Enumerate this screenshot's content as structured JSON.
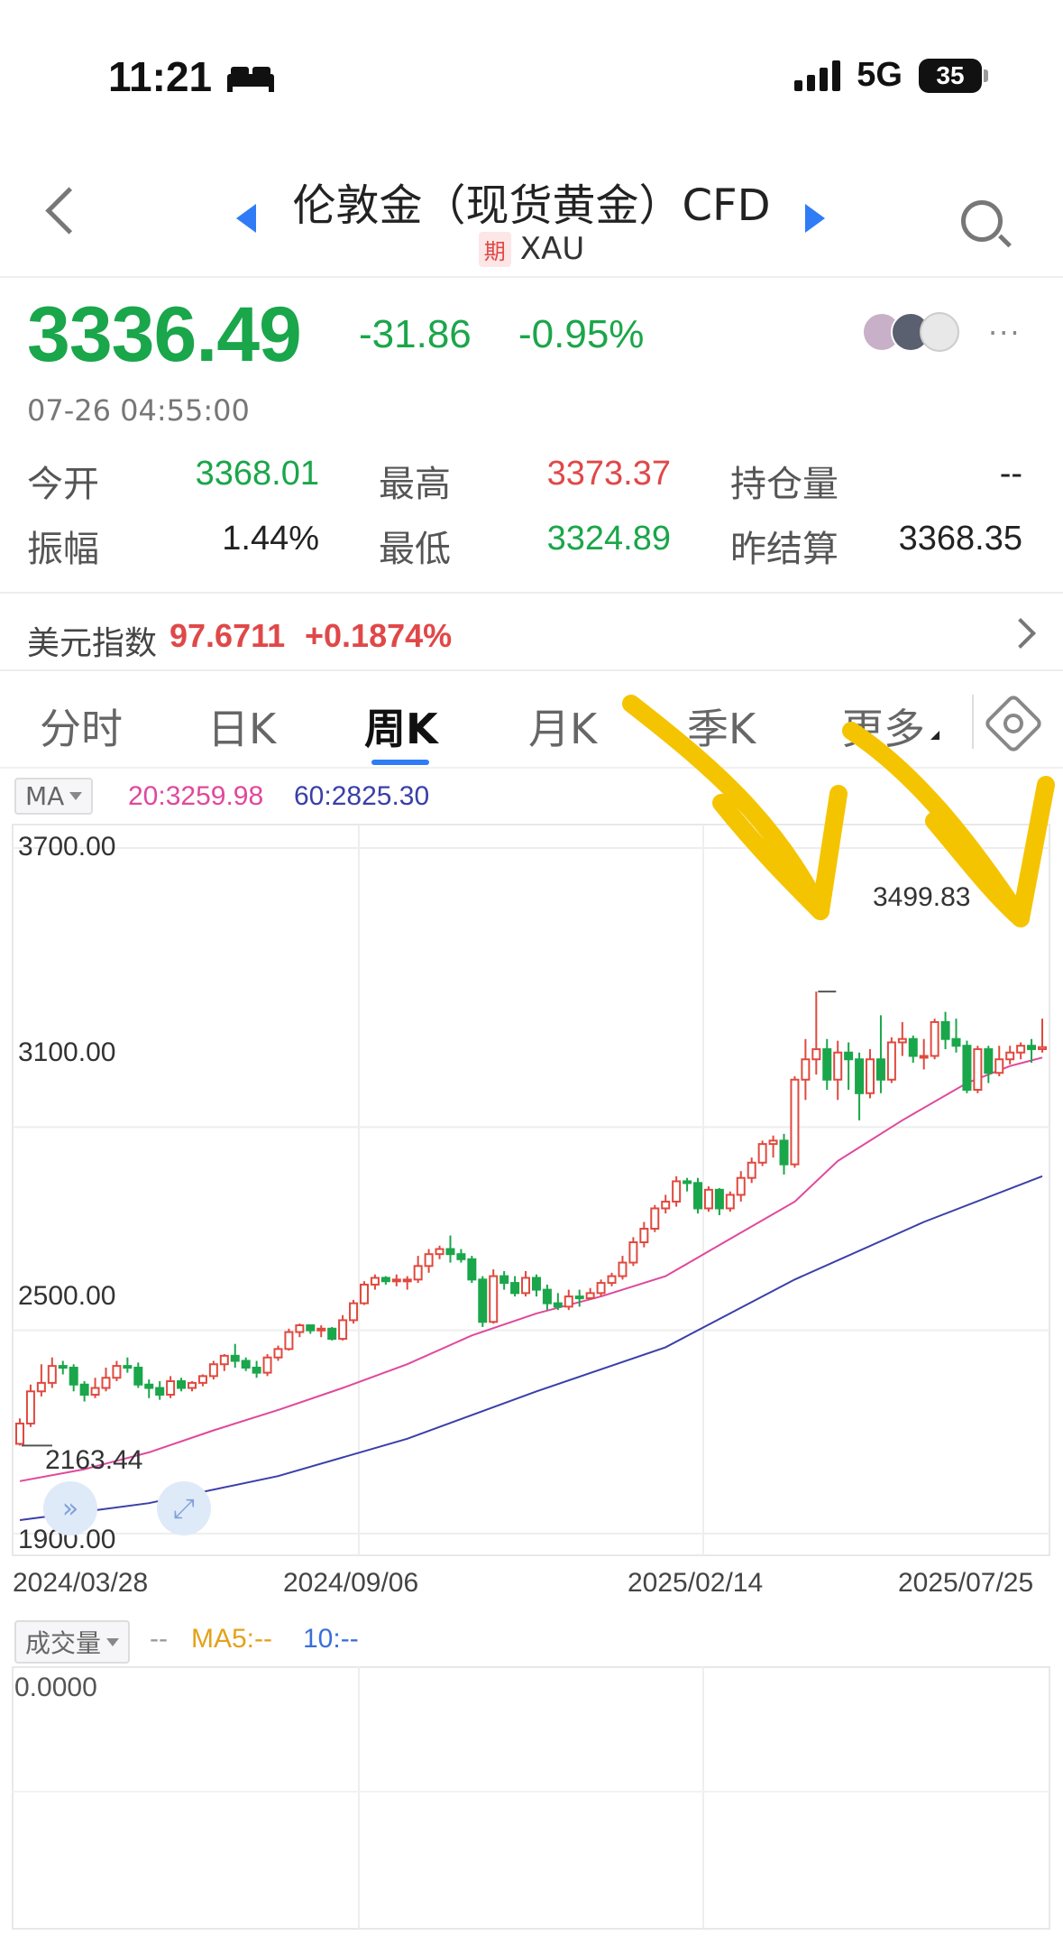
{
  "status_bar": {
    "time": "11:21",
    "network": "5G",
    "battery": "35"
  },
  "header": {
    "title": "伦敦金（现货黄金）CFD",
    "badge": "期",
    "symbol": "XAU"
  },
  "quote": {
    "price": "3336.49",
    "change": "-31.86",
    "change_pct": "-0.95%",
    "timestamp": "07-26 04:55:00",
    "colors": {
      "down": "#1aa64a",
      "up": "#e04848"
    }
  },
  "stats": {
    "open_label": "今开",
    "open": "3368.01",
    "high_label": "最高",
    "high": "3373.37",
    "oi_label": "持仓量",
    "oi": "--",
    "amp_label": "振幅",
    "amp": "1.44%",
    "low_label": "最低",
    "low": "3324.89",
    "settle_label": "昨结算",
    "settle": "3368.35"
  },
  "dxy": {
    "label": "美元指数",
    "value": "97.6711",
    "change": "+0.1874%"
  },
  "tabs": [
    "分时",
    "日K",
    "周K",
    "月K",
    "季K",
    "更多"
  ],
  "active_tab": "周K",
  "ma_legend": {
    "select": "MA",
    "ma20": "20:3259.98",
    "ma60": "60:2825.30"
  },
  "chart_data": {
    "type": "candlestick",
    "y_ticks": [
      "3700.00",
      "3100.00",
      "2500.00",
      "1900.00"
    ],
    "y_range": [
      1900,
      3700
    ],
    "x_ticks": [
      "2024/03/28",
      "2024/09/06",
      "2025/02/14",
      "2025/07/25"
    ],
    "high_marker": "3499.83",
    "low_marker": "2163.44",
    "colors": {
      "up": "#e0493f",
      "down": "#1aa64a",
      "ma20": "#e0489c",
      "ma60": "#3a3fa8",
      "annotation": "#f5c400"
    },
    "candles": [
      [
        2165,
        2225,
        2160,
        2240
      ],
      [
        2225,
        2320,
        2215,
        2340
      ],
      [
        2320,
        2345,
        2305,
        2400
      ],
      [
        2345,
        2395,
        2330,
        2420
      ],
      [
        2395,
        2390,
        2370,
        2410
      ],
      [
        2390,
        2340,
        2320,
        2400
      ],
      [
        2340,
        2310,
        2290,
        2350
      ],
      [
        2310,
        2330,
        2300,
        2360
      ],
      [
        2330,
        2360,
        2320,
        2390
      ],
      [
        2360,
        2395,
        2350,
        2410
      ],
      [
        2395,
        2390,
        2375,
        2420
      ],
      [
        2390,
        2340,
        2330,
        2405
      ],
      [
        2340,
        2330,
        2300,
        2355
      ],
      [
        2330,
        2310,
        2295,
        2350
      ],
      [
        2310,
        2350,
        2300,
        2365
      ],
      [
        2350,
        2330,
        2320,
        2360
      ],
      [
        2330,
        2345,
        2320,
        2350
      ],
      [
        2345,
        2365,
        2335,
        2370
      ],
      [
        2365,
        2400,
        2355,
        2410
      ],
      [
        2400,
        2425,
        2380,
        2430
      ],
      [
        2425,
        2410,
        2390,
        2460
      ],
      [
        2410,
        2390,
        2380,
        2420
      ],
      [
        2390,
        2375,
        2360,
        2410
      ],
      [
        2375,
        2420,
        2365,
        2430
      ],
      [
        2420,
        2445,
        2410,
        2455
      ],
      [
        2445,
        2495,
        2440,
        2505
      ],
      [
        2495,
        2515,
        2480,
        2520
      ],
      [
        2515,
        2500,
        2490,
        2515
      ],
      [
        2500,
        2505,
        2480,
        2515
      ],
      [
        2505,
        2475,
        2470,
        2510
      ],
      [
        2475,
        2530,
        2470,
        2545
      ],
      [
        2530,
        2580,
        2520,
        2590
      ],
      [
        2580,
        2635,
        2575,
        2645
      ],
      [
        2635,
        2655,
        2620,
        2665
      ],
      [
        2655,
        2645,
        2635,
        2660
      ],
      [
        2645,
        2650,
        2630,
        2665
      ],
      [
        2650,
        2650,
        2620,
        2660
      ],
      [
        2650,
        2690,
        2640,
        2720
      ],
      [
        2690,
        2725,
        2670,
        2740
      ],
      [
        2725,
        2740,
        2710,
        2750
      ],
      [
        2740,
        2725,
        2700,
        2780
      ],
      [
        2725,
        2710,
        2700,
        2740
      ],
      [
        2710,
        2650,
        2640,
        2720
      ],
      [
        2650,
        2525,
        2510,
        2660
      ],
      [
        2525,
        2660,
        2520,
        2680
      ],
      [
        2660,
        2640,
        2620,
        2675
      ],
      [
        2640,
        2610,
        2600,
        2660
      ],
      [
        2610,
        2655,
        2600,
        2675
      ],
      [
        2655,
        2620,
        2600,
        2665
      ],
      [
        2620,
        2580,
        2560,
        2635
      ],
      [
        2580,
        2570,
        2560,
        2610
      ],
      [
        2570,
        2600,
        2560,
        2620
      ],
      [
        2600,
        2595,
        2570,
        2620
      ],
      [
        2595,
        2610,
        2590,
        2625
      ],
      [
        2610,
        2640,
        2600,
        2650
      ],
      [
        2640,
        2660,
        2630,
        2670
      ],
      [
        2660,
        2700,
        2650,
        2720
      ],
      [
        2700,
        2760,
        2690,
        2775
      ],
      [
        2760,
        2800,
        2745,
        2820
      ],
      [
        2800,
        2860,
        2790,
        2870
      ],
      [
        2860,
        2880,
        2845,
        2900
      ],
      [
        2880,
        2940,
        2865,
        2955
      ],
      [
        2940,
        2935,
        2910,
        2950
      ],
      [
        2935,
        2860,
        2845,
        2950
      ],
      [
        2860,
        2915,
        2850,
        2925
      ],
      [
        2915,
        2860,
        2840,
        2920
      ],
      [
        2860,
        2900,
        2850,
        2910
      ],
      [
        2900,
        2950,
        2880,
        2970
      ],
      [
        2950,
        2995,
        2935,
        3010
      ],
      [
        2995,
        3050,
        2985,
        3060
      ],
      [
        3050,
        3060,
        3010,
        3075
      ],
      [
        3060,
        2990,
        2960,
        3080
      ],
      [
        2990,
        3240,
        2980,
        3250
      ],
      [
        3240,
        3300,
        3180,
        3360
      ],
      [
        3300,
        3330,
        3255,
        3500
      ],
      [
        3330,
        3240,
        3210,
        3360
      ],
      [
        3240,
        3320,
        3180,
        3355
      ],
      [
        3320,
        3300,
        3210,
        3350
      ],
      [
        3300,
        3200,
        3120,
        3320
      ],
      [
        3200,
        3300,
        3185,
        3330
      ],
      [
        3300,
        3240,
        3200,
        3430
      ],
      [
        3240,
        3350,
        3230,
        3365
      ],
      [
        3350,
        3360,
        3310,
        3410
      ],
      [
        3360,
        3310,
        3290,
        3370
      ],
      [
        3310,
        3310,
        3270,
        3360
      ],
      [
        3310,
        3410,
        3300,
        3420
      ],
      [
        3410,
        3360,
        3330,
        3440
      ],
      [
        3360,
        3340,
        3320,
        3420
      ],
      [
        3340,
        3210,
        3200,
        3355
      ],
      [
        3210,
        3330,
        3200,
        3340
      ],
      [
        3330,
        3260,
        3230,
        3340
      ],
      [
        3260,
        3300,
        3250,
        3340
      ],
      [
        3300,
        3320,
        3285,
        3340
      ],
      [
        3320,
        3340,
        3300,
        3350
      ],
      [
        3340,
        3330,
        3290,
        3360
      ],
      [
        3330,
        3336,
        3320,
        3420
      ]
    ],
    "ma20": [
      [
        0,
        2055
      ],
      [
        6,
        2090
      ],
      [
        12,
        2140
      ],
      [
        18,
        2205
      ],
      [
        24,
        2265
      ],
      [
        30,
        2330
      ],
      [
        36,
        2400
      ],
      [
        42,
        2485
      ],
      [
        48,
        2550
      ],
      [
        54,
        2600
      ],
      [
        60,
        2660
      ],
      [
        66,
        2770
      ],
      [
        72,
        2880
      ],
      [
        76,
        3000
      ],
      [
        82,
        3120
      ],
      [
        88,
        3230
      ],
      [
        92,
        3280
      ],
      [
        95,
        3305
      ]
    ],
    "ma60": [
      [
        0,
        1940
      ],
      [
        12,
        1990
      ],
      [
        24,
        2070
      ],
      [
        36,
        2180
      ],
      [
        48,
        2320
      ],
      [
        60,
        2450
      ],
      [
        72,
        2650
      ],
      [
        84,
        2820
      ],
      [
        95,
        2955
      ]
    ]
  },
  "volume": {
    "select": "成交量",
    "value": "--",
    "ma5": "MA5:--",
    "ma10": "10:--",
    "y_tick": "0.0000"
  }
}
